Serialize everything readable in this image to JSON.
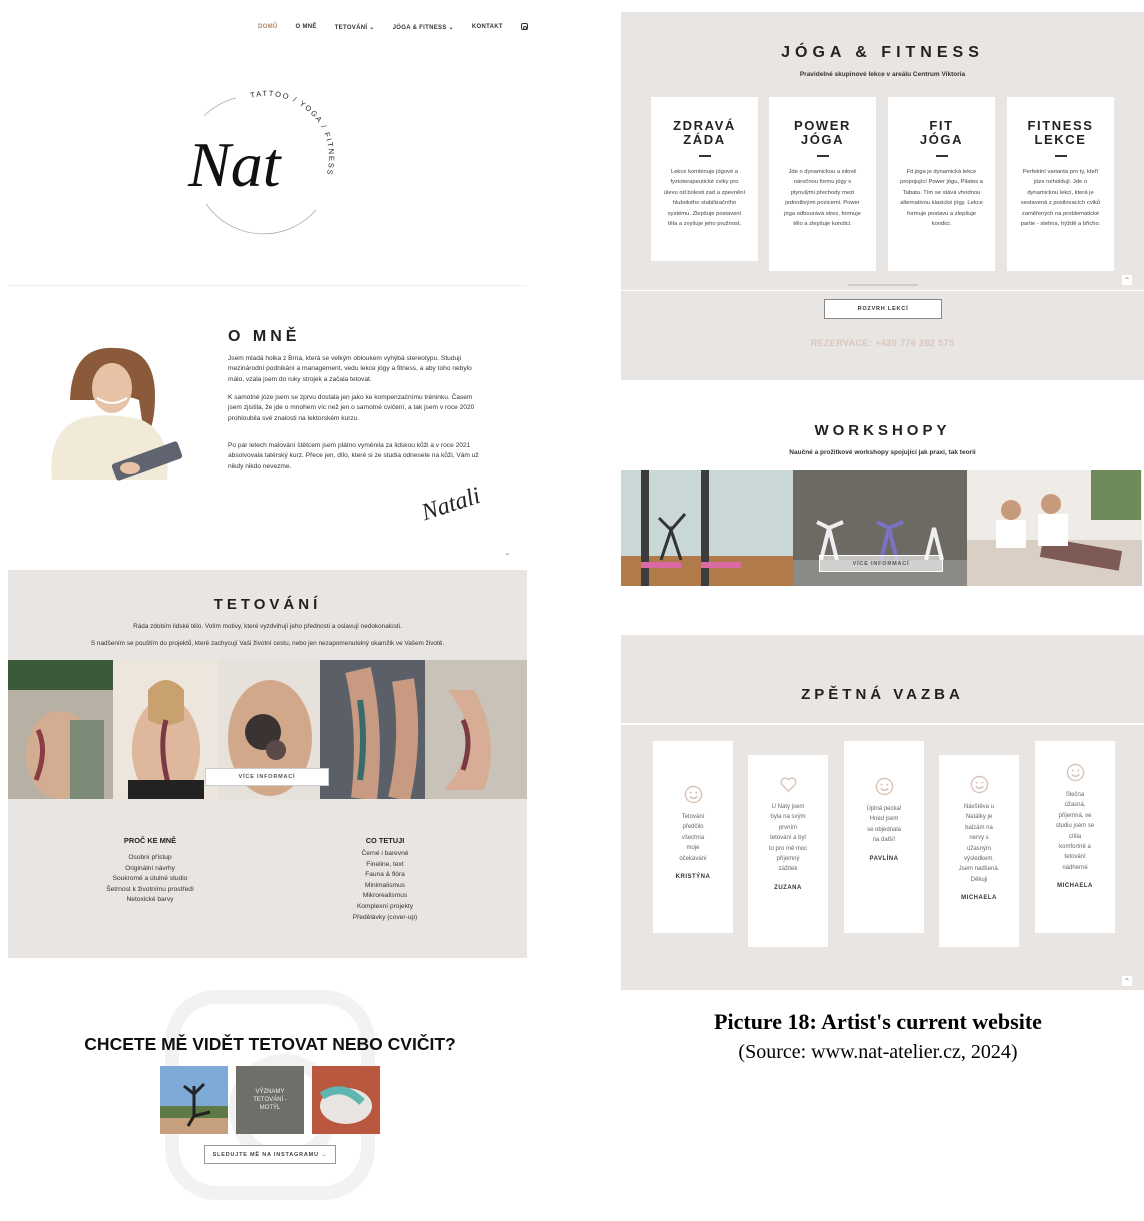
{
  "nav": {
    "items": [
      "DOMŮ",
      "O MNĚ",
      "TETOVÁNÍ ⌄",
      "JÓGA & FITNESS ⌄",
      "KONTAKT"
    ],
    "instagram_icon": "instagram-icon"
  },
  "logo": {
    "script": "Nat",
    "ring_text": "TATTOO / YOGA / FITNESS"
  },
  "about": {
    "title": "O MNĚ",
    "p1": "Jsem mladá holka z Brna, která se velkým obloukem vyhýbá stereotypu. Studuji mezinárodní podnikání a management, vedu lekce jógy a fitness, a aby toho nebylo málo, vzala jsem do ruky strojek a začala tetovat.",
    "p2": "K samotné józe jsem se zprvu dostala jen jako ke kompenzačnímu tréninku. Časem jsem zjistila, že jde o mnohem víc než jen o samotné cvičení, a tak jsem v roce 2020 prohloubila své znalosti na lektorském kurzu.",
    "p3": "Po pár letech malování štětcem jsem plátno vyměnila za lidskou kůži a v roce 2021 absolvovala tatérský kurz. Přece jen, dílo, které si ze studia odnesete na kůži, Vám už nikdy nikdo nevezme.",
    "signature": "Natali"
  },
  "tattoo": {
    "title": "TETOVÁNÍ",
    "sub1": "Ráda zdobím lidské tělo. Volím motivy, které vyzdvihují jeho přednosti a oslavují nedokonalosti.",
    "sub2": "S nadšením se pouštím do projektů, které zachycují Vaši životní cestu, nebo jen nezapomenutelný okamžik ve Vašem životě.",
    "more_button": "VÍCE INFORMACÍ",
    "why_title": "PROČ KE MNĚ",
    "why_items": [
      "Osobní přístup",
      "Originální návrhy",
      "Soukromé a útulné studio",
      "Šetrnost k životnímu prostředí",
      "Netoxické barvy"
    ],
    "what_title": "CO TETUJI",
    "what_items": [
      "Černé i barevné",
      "Fineline, text",
      "Fauna & flóra",
      "Minimalismus",
      "Mikrorealismus",
      "Komplexní projekty",
      "Předělávky (cover-up)"
    ]
  },
  "cta": {
    "title": "CHCETE MĚ VIDĚT TETOVAT NEBO CVIČIT?",
    "thumb_text": "VÝZNAMY TETOVÁNÍ - MOTÝL",
    "button": "SLEDUJTE MĚ NA INSTAGRAMU →"
  },
  "yoga": {
    "title": "JÓGA & FITNESS",
    "subtitle": "Pravidelné skupinové lekce v areálu Centrum Viktoria",
    "cards": [
      {
        "line1": "ZDRAVÁ",
        "line2": "ZÁDA",
        "text": "Lekce kombinuje jógové a fyzioterapeutické cviky pro úlevu od bolesti zad a zpevnění hlubokého stabilizačního systému. Zlepšuje postavení těla a zvyšuje jeho pružnost."
      },
      {
        "line1": "POWER",
        "line2": "JÓGA",
        "text": "Jde o dynamickou a silově náročnou formu jógy s plynulými přechody mezi jednotlivými pozicemi. Power jóga odbourává stres, formuje tělo a zlepšuje kondici."
      },
      {
        "line1": "FIT",
        "line2": "JÓGA",
        "text": "Fit jóga je dynamická lekce propojující Power jógu, Pilates a Tabatu. Tím se stává vhodnou alternativou klasické jógy. Lekce formuje postavu a zlepšuje kondici."
      },
      {
        "line1": "FITNESS",
        "line2": "LEKCE",
        "text": "Perfektní varianta pro ty, kteří józe neholdují. Jde o dynamickou lekci, která je sestavená z posilovacích cviků zaměřených na problematické partie - stehna, hýždě a břicho."
      }
    ],
    "schedule_button": "ROZVRH LEKCÍ",
    "reservation": "REZERVACE: +420 776 282 575"
  },
  "workshops": {
    "title": "WORKSHOPY",
    "subtitle": "Naučné a prožitkové workshopy spojující jak praxi, tak teorii",
    "more_button": "VÍCE INFORMACÍ"
  },
  "feedback": {
    "title": "ZPĚTNÁ VAZBA",
    "cards": [
      {
        "icon": "smile-icon",
        "text": "Tetování předčilo všechna moje očekávání",
        "name": "KRISTÝNA"
      },
      {
        "icon": "heart-icon",
        "text": "U Naty jsem byla na svým prvním tetování a byl to pro mě moc příjemný zážitek",
        "name": "ZUZANA"
      },
      {
        "icon": "smile-icon",
        "text": "Úplná pecka! Hned jsem se objednala na další!",
        "name": "PAVLÍNA"
      },
      {
        "icon": "smile-icon",
        "text": "Návštěva u Natálky je balzám na nervy s úžasným výsledkem. Jsem nadšená. Děkuji",
        "name": "MICHAELA"
      },
      {
        "icon": "smile-icon",
        "text": "Slečna úžasná, příjemná, ve studiu jsem se cítila komfortně a tetování nádherné",
        "name": "MICHAELA"
      }
    ]
  },
  "caption": {
    "title": "Picture 18: Artist's current website",
    "source": "(Source: www.nat-atelier.cz, 2024)"
  },
  "colors": {
    "accent": "#b0866a",
    "section_bg": "#e9e5e3",
    "reservation": "#d9c7bd"
  }
}
